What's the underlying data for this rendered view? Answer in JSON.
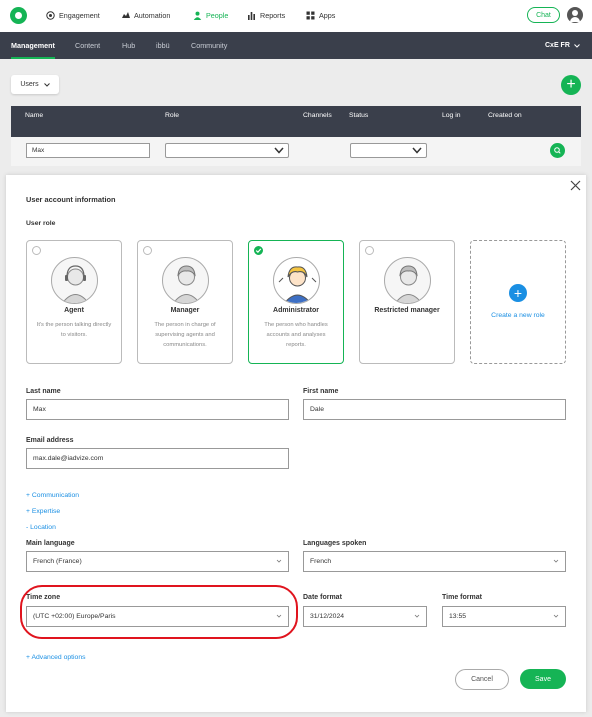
{
  "topnav": {
    "items": [
      {
        "label": "Engagement",
        "icon": "target-icon"
      },
      {
        "label": "Automation",
        "icon": "automation-icon"
      },
      {
        "label": "People",
        "icon": "person-icon"
      },
      {
        "label": "Reports",
        "icon": "bar-chart-icon"
      },
      {
        "label": "Apps",
        "icon": "grid-icon"
      }
    ],
    "chat_label": "Chat",
    "accent": "#15b455"
  },
  "subnav": {
    "tabs": [
      "Management",
      "Content",
      "Hub",
      "ibbü",
      "Community"
    ],
    "language": "CxE FR"
  },
  "users_dropdown": "Users",
  "table": {
    "headers": [
      "Name",
      "Role",
      "Channels",
      "Status",
      "Log in",
      "Created on"
    ],
    "filter_name_value": "Max"
  },
  "modal": {
    "section_title": "User account information",
    "user_role_label": "User role",
    "roles": [
      {
        "title": "Agent",
        "desc": "It's the person talking directly to visitors."
      },
      {
        "title": "Manager",
        "desc": "The person in charge of supervising agents and communications."
      },
      {
        "title": "Administrator",
        "desc": "The person who handles accounts and analyses reports."
      },
      {
        "title": "Restricted manager",
        "desc": ""
      }
    ],
    "create_role_label": "Create a new role",
    "last_name_label": "Last name",
    "last_name_value": "Max",
    "first_name_label": "First name",
    "first_name_value": "Dale",
    "email_label": "Email address",
    "email_value": "max.dale@iadvize.com",
    "links": [
      "+ Communication",
      "+ Expertise",
      "- Location"
    ],
    "main_language_label": "Main language",
    "main_language_value": "French (France)",
    "languages_spoken_label": "Languages spoken",
    "languages_spoken_value": "French",
    "time_zone_label": "Time zone",
    "time_zone_value": "(UTC +02:00) Europe/Paris",
    "date_format_label": "Date format",
    "date_format_value": "31/12/2024",
    "time_format_label": "Time format",
    "time_format_value": "13:55",
    "advanced_options_label": "+ Advanced options",
    "cancel_label": "Cancel",
    "save_label": "Save"
  }
}
